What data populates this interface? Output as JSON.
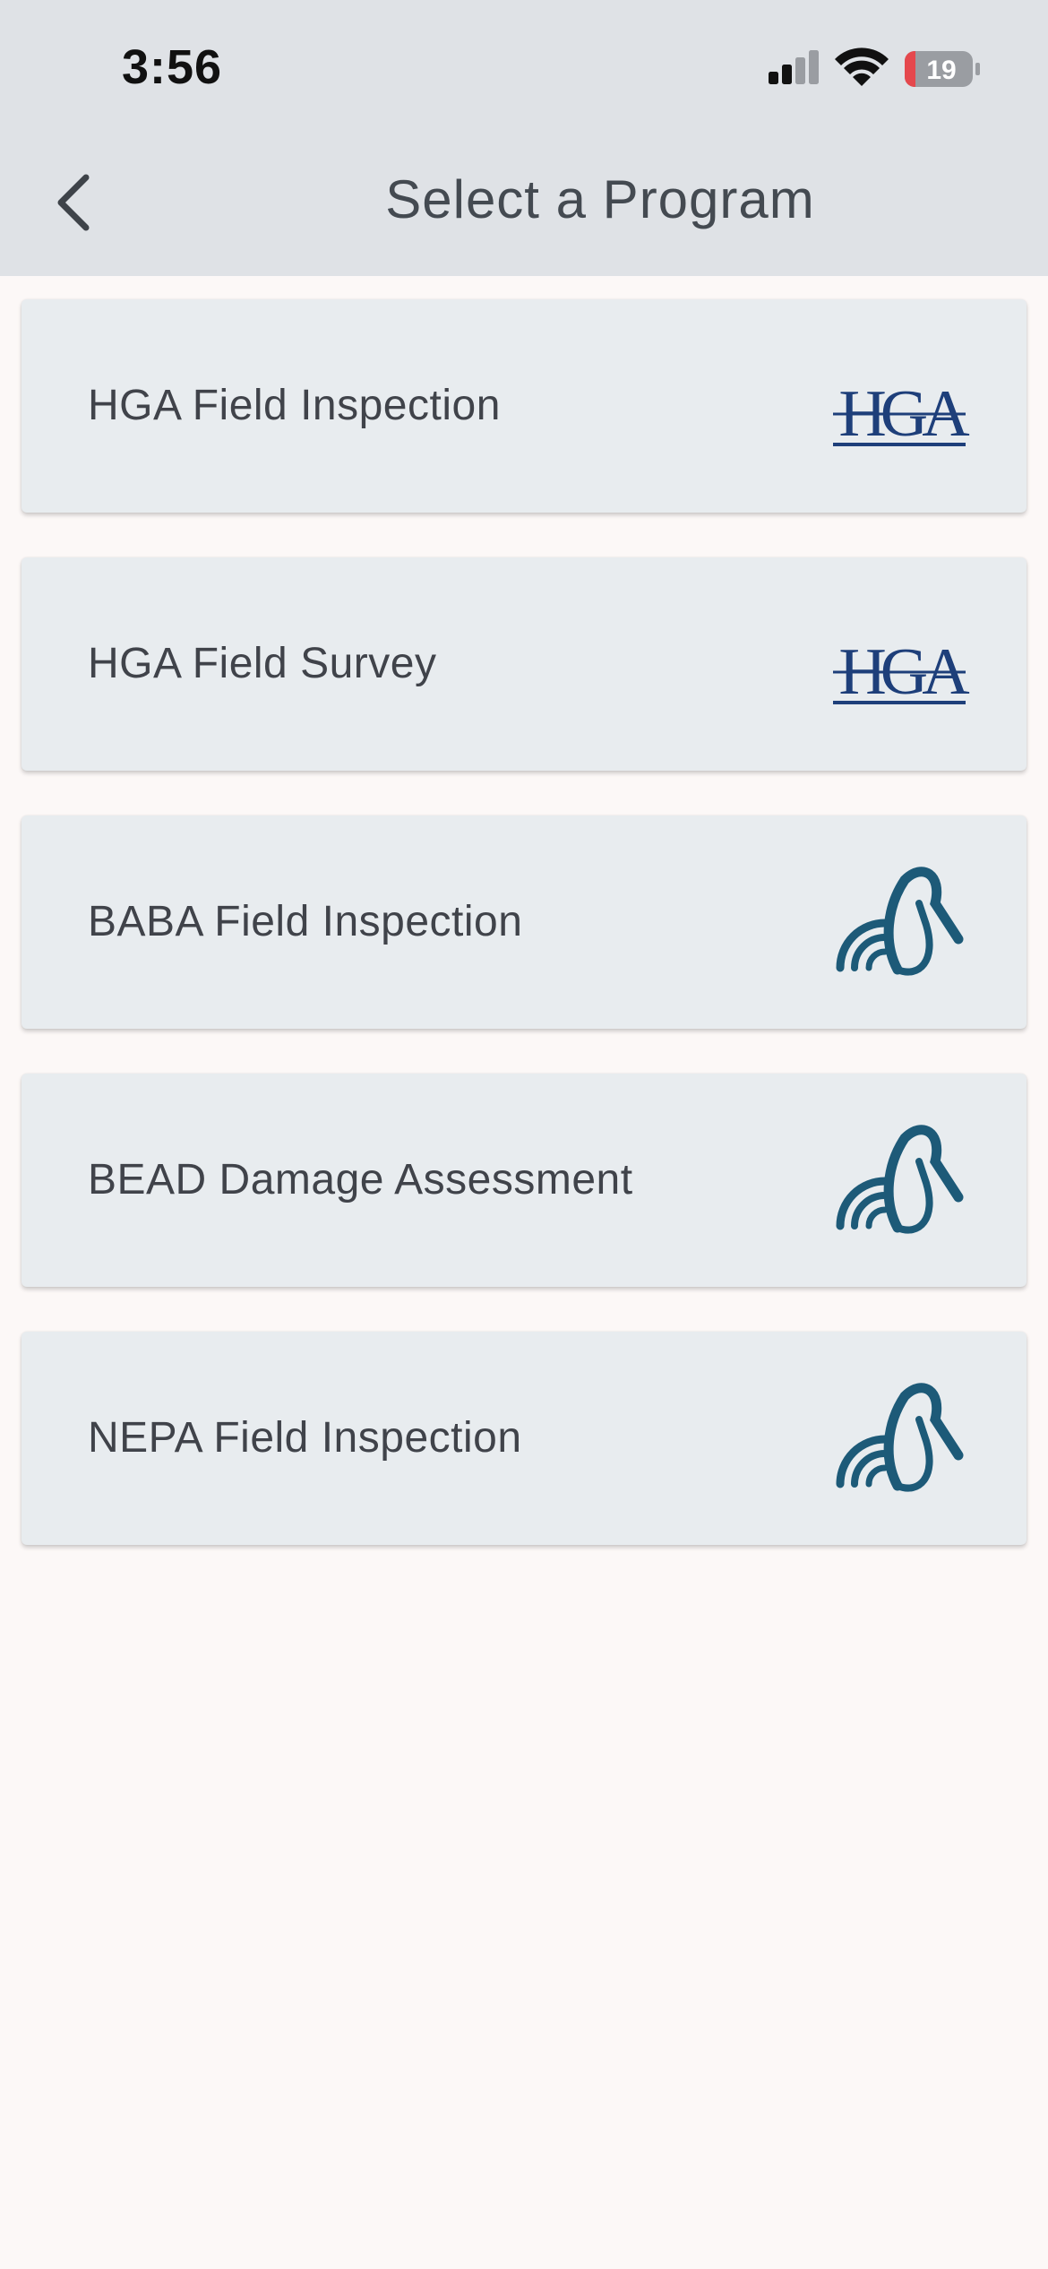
{
  "status_bar": {
    "time": "3:56",
    "battery": "19",
    "icons": [
      "cellular-signal-icon",
      "wifi-icon",
      "battery-icon"
    ]
  },
  "header": {
    "title": "Select a Program",
    "back_icon": "chevron-left-icon"
  },
  "programs": [
    {
      "label": "HGA Field Inspection",
      "logo": "hga-logo",
      "logo_text": "HGA"
    },
    {
      "label": "HGA Field Survey",
      "logo": "hga-logo",
      "logo_text": "HGA"
    },
    {
      "label": "BABA Field Inspection",
      "logo": "signal-brand-logo"
    },
    {
      "label": "BEAD Damage Assessment",
      "logo": "signal-brand-logo"
    },
    {
      "label": "NEPA Field Inspection",
      "logo": "signal-brand-logo"
    }
  ],
  "colors": {
    "header_bg": "#dfe2e6",
    "page_bg": "#fcf8f7",
    "card_bg": "#e8ecef",
    "text": "#40434a",
    "hga_blue": "#1e3f7a",
    "brand_teal": "#1d5a78",
    "battery_red": "#e5484d"
  }
}
